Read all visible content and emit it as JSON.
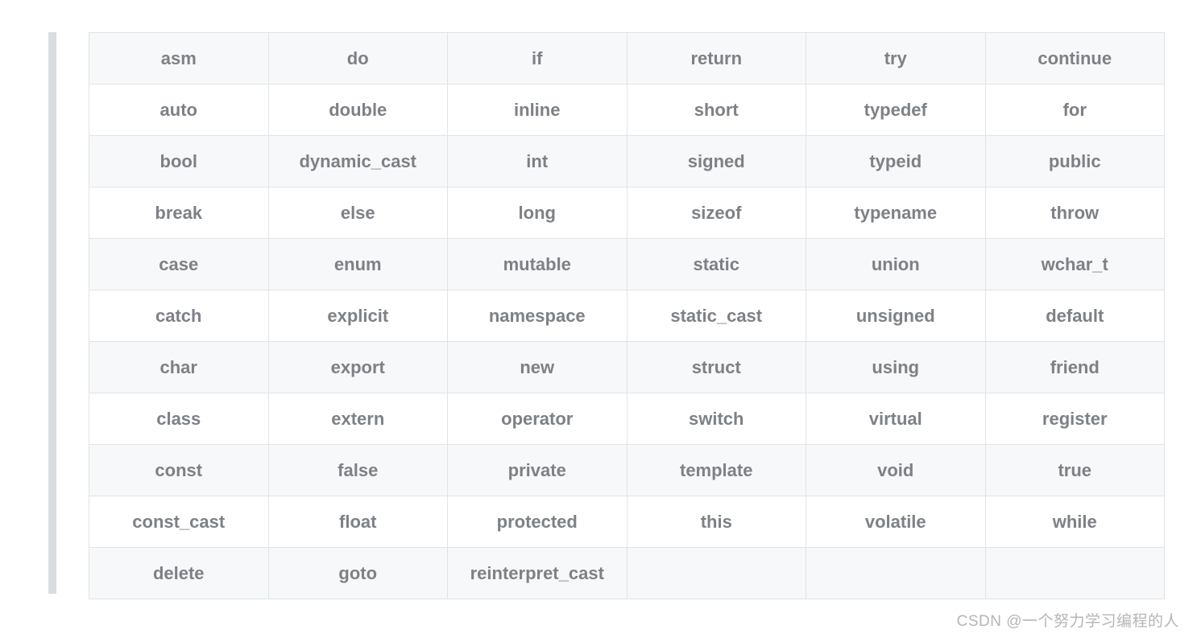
{
  "table": {
    "rows": [
      [
        "asm",
        "do",
        "if",
        "return",
        "try",
        "continue"
      ],
      [
        "auto",
        "double",
        "inline",
        "short",
        "typedef",
        "for"
      ],
      [
        "bool",
        "dynamic_cast",
        "int",
        "signed",
        "typeid",
        "public"
      ],
      [
        "break",
        "else",
        "long",
        "sizeof",
        "typename",
        "throw"
      ],
      [
        "case",
        "enum",
        "mutable",
        "static",
        "union",
        "wchar_t"
      ],
      [
        "catch",
        "explicit",
        "namespace",
        "static_cast",
        "unsigned",
        "default"
      ],
      [
        "char",
        "export",
        "new",
        "struct",
        "using",
        "friend"
      ],
      [
        "class",
        "extern",
        "operator",
        "switch",
        "virtual",
        "register"
      ],
      [
        "const",
        "false",
        "private",
        "template",
        "void",
        "true"
      ],
      [
        "const_cast",
        "float",
        "protected",
        "this",
        "volatile",
        "while"
      ],
      [
        "delete",
        "goto",
        "reinterpret_cast",
        "",
        "",
        ""
      ]
    ]
  },
  "watermark": "CSDN @一个努力学习编程的人"
}
